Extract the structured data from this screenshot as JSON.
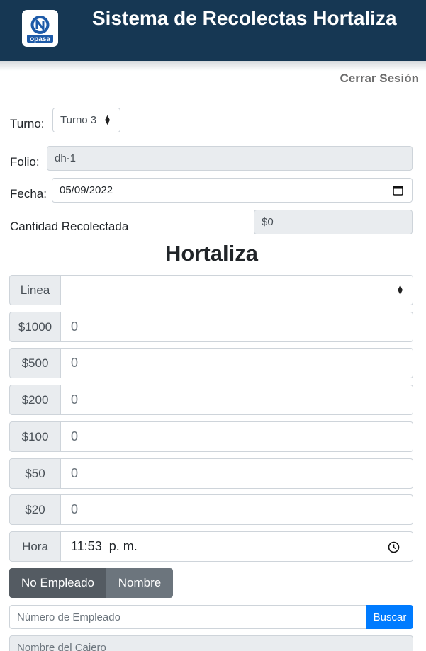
{
  "header": {
    "title": "Sistema de Recolectas Hortaliza",
    "logo_text": "opasa",
    "brand_color": "#163753"
  },
  "logout_label": "Cerrar Sesión",
  "form": {
    "turno_label": "Turno:",
    "turno_value": "Turno 3",
    "folio_label": "Folio:",
    "folio_value": "dh-1",
    "fecha_label": "Fecha:",
    "fecha_value": "05/09/2022",
    "cantidad_label": "Cantidad Recolectada",
    "cantidad_value": "$0"
  },
  "section_title": "Hortaliza",
  "linea": {
    "label": "Linea",
    "value": ""
  },
  "denominations": [
    {
      "label": "$1000",
      "value": "0"
    },
    {
      "label": "$500",
      "value": "0"
    },
    {
      "label": "$200",
      "value": "0"
    },
    {
      "label": "$100",
      "value": "0"
    },
    {
      "label": "$50",
      "value": "0"
    },
    {
      "label": "$20",
      "value": "0"
    }
  ],
  "hora": {
    "label": "Hora",
    "value": "11:53  p. m."
  },
  "search_mode": {
    "option_active": "No Empleado",
    "option_other": "Nombre"
  },
  "search": {
    "placeholder": "Número de Empleado",
    "button_label": "Buscar"
  },
  "cashier": {
    "placeholder": "Nombre del Cajero"
  },
  "icons": {
    "select_arrow": "updown-caret-icon",
    "calendar": "calendar-icon",
    "clock": "clock-icon"
  },
  "colors": {
    "primary_button": "#007bff",
    "toggle_active": "#545b62",
    "toggle_other": "#6c757d"
  }
}
